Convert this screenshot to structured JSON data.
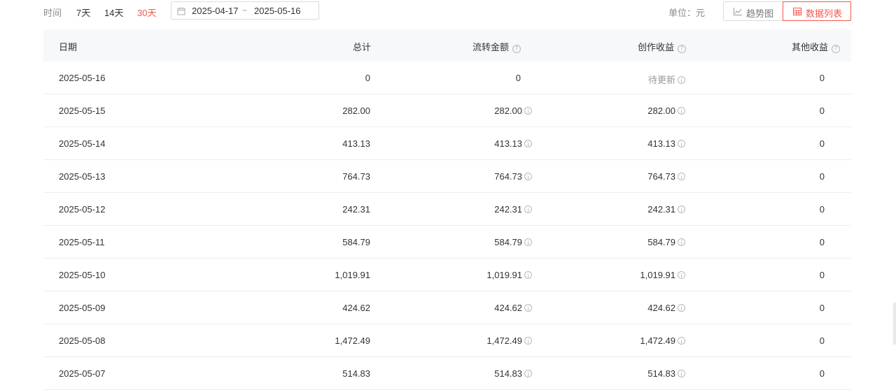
{
  "filters": {
    "time_label": "时间",
    "ranges": [
      {
        "label": "7天",
        "active": false
      },
      {
        "label": "14天",
        "active": false
      },
      {
        "label": "30天",
        "active": true
      }
    ],
    "date_start": "2025-04-17",
    "date_sep": "~",
    "date_end": "2025-05-16",
    "unit": "单位：元",
    "view_trend": "趋势图",
    "view_list": "数据列表"
  },
  "colors": {
    "accent": "#f5564a",
    "header_bg": "#f7f8fa",
    "muted": "#8a8a8a"
  },
  "table": {
    "headers": {
      "date": "日期",
      "total": "总计",
      "flow": "流转金额",
      "create": "创作收益",
      "other": "其他收益"
    },
    "rows": [
      {
        "date": "2025-05-16",
        "total": "0",
        "flow": "0",
        "create": "待更新",
        "other": "0"
      },
      {
        "date": "2025-05-15",
        "total": "282.00",
        "flow": "282.00",
        "create": "282.00",
        "other": "0"
      },
      {
        "date": "2025-05-14",
        "total": "413.13",
        "flow": "413.13",
        "create": "413.13",
        "other": "0"
      },
      {
        "date": "2025-05-13",
        "total": "764.73",
        "flow": "764.73",
        "create": "764.73",
        "other": "0"
      },
      {
        "date": "2025-05-12",
        "total": "242.31",
        "flow": "242.31",
        "create": "242.31",
        "other": "0"
      },
      {
        "date": "2025-05-11",
        "total": "584.79",
        "flow": "584.79",
        "create": "584.79",
        "other": "0"
      },
      {
        "date": "2025-05-10",
        "total": "1,019.91",
        "flow": "1,019.91",
        "create": "1,019.91",
        "other": "0"
      },
      {
        "date": "2025-05-09",
        "total": "424.62",
        "flow": "424.62",
        "create": "424.62",
        "other": "0"
      },
      {
        "date": "2025-05-08",
        "total": "1,472.49",
        "flow": "1,472.49",
        "create": "1,472.49",
        "other": "0"
      },
      {
        "date": "2025-05-07",
        "total": "514.83",
        "flow": "514.83",
        "create": "514.83",
        "other": "0"
      }
    ]
  }
}
